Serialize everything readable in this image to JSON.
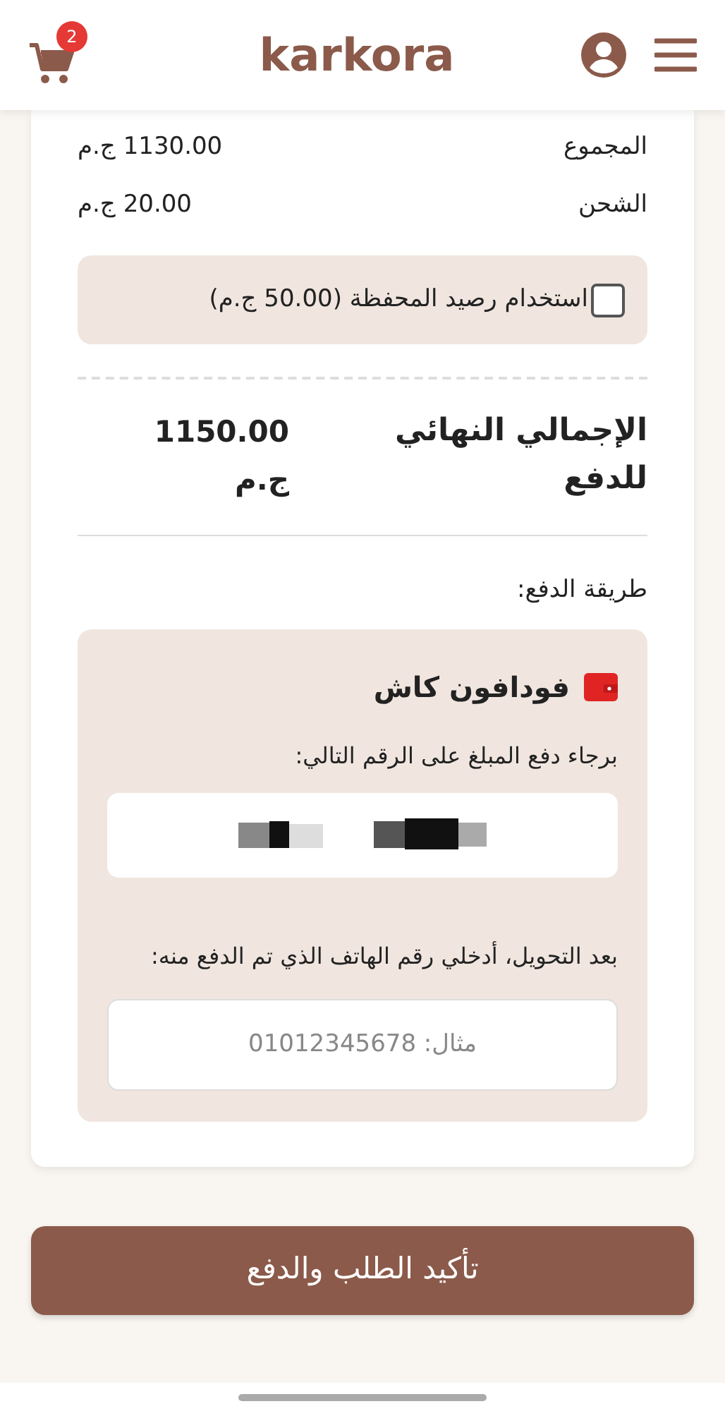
{
  "header": {
    "cart_count": "2",
    "logo": "karkora"
  },
  "summary": [
    {
      "label": "المجموع",
      "value": "1130.00 ج.م"
    },
    {
      "label": "الشحن",
      "value": "20.00 ج.م"
    }
  ],
  "wallet": {
    "label": "استخدام رصيد المحفظة (50.00 ج.م)",
    "checked": false
  },
  "total": {
    "label": "الإجمالي النهائي للدفع",
    "value": "1150.00 ج.م"
  },
  "payment_method_label": "طريقة الدفع:",
  "payment_option": {
    "name": "فودافون كاش",
    "instruction": "برجاء دفع المبلغ على الرقم التالي:",
    "confirm_prompt": "بعد التحويل، أدخلي رقم الهاتف الذي تم الدفع منه:",
    "phone_field": {
      "placeholder": "مثال: 01012345678"
    }
  },
  "submit_button": "تأكيد الطلب والدفع"
}
